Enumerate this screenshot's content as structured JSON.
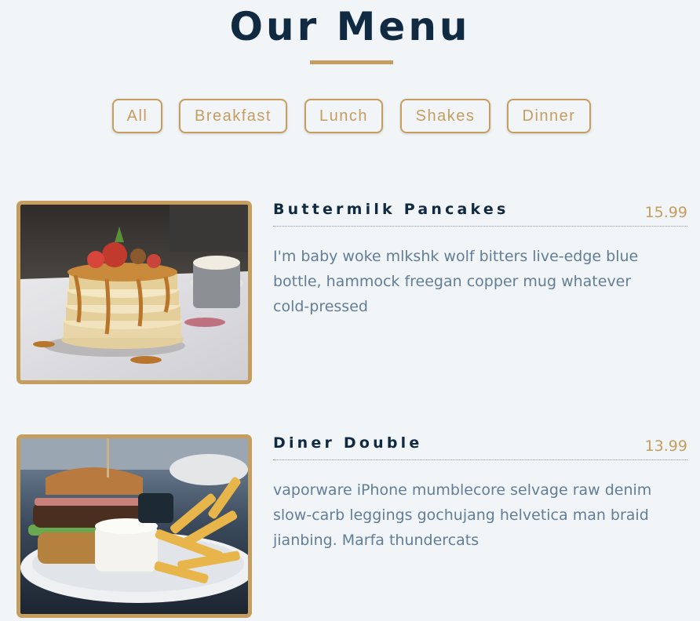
{
  "title": "Our Menu",
  "colors": {
    "accent": "#c59d5f",
    "heading": "#102a42",
    "text": "#617d98",
    "background": "#f1f5f8"
  },
  "filters": [
    "All",
    "Breakfast",
    "Lunch",
    "Shakes",
    "Dinner"
  ],
  "items": [
    {
      "name": "Buttermilk Pancakes",
      "price": "15.99",
      "description": "I'm baby woke mlkshk wolf bitters live-edge blue bottle, hammock freegan copper mug whatever cold-pressed",
      "image": "pancakes-photo"
    },
    {
      "name": "Diner Double",
      "price": "13.99",
      "description": "vaporware iPhone mumblecore selvage raw denim slow-carb leggings gochujang helvetica man braid jianbing. Marfa thundercats",
      "image": "burger-photo"
    }
  ]
}
